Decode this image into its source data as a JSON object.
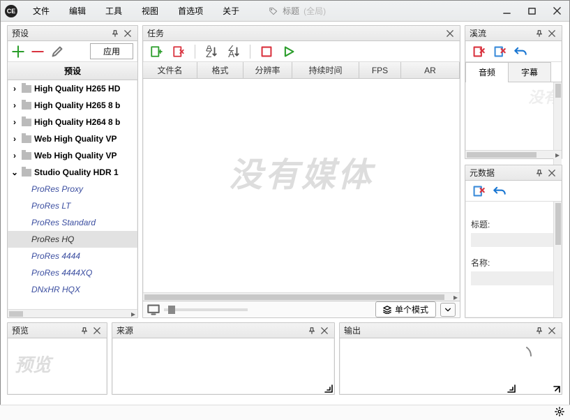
{
  "menubar": [
    "文件",
    "编辑",
    "工具",
    "视图",
    "首选项",
    "关于"
  ],
  "tag_label": "标题",
  "tag_scope": "(全局)",
  "panels": {
    "presets": "预设",
    "tasks": "任务",
    "streams": "溪流",
    "metadata": "元数据",
    "preview": "预览",
    "source": "来源",
    "output": "输出"
  },
  "presets": {
    "apply": "应用",
    "header": "预设",
    "folders": [
      "High Quality H265 HD",
      "High Quality H265 8 b",
      "High Quality H264 8 b",
      "Web High Quality VP",
      "Web High Quality VP",
      "Studio Quality HDR 1"
    ],
    "open_index": 5,
    "children": [
      "ProRes Proxy",
      "ProRes LT",
      "ProRes Standard",
      "ProRes HQ",
      "ProRes 4444",
      "ProRes 4444XQ",
      "DNxHR HQX"
    ],
    "selected_child": "ProRes HQ"
  },
  "tasks": {
    "columns": [
      "文件名",
      "格式",
      "分辨率",
      "持续时间",
      "FPS",
      "AR"
    ],
    "watermark": "没有媒体",
    "mode": "单个模式"
  },
  "streams": {
    "tabs": [
      "音频",
      "字幕"
    ],
    "active": 0,
    "ghost": "没有"
  },
  "metadata": {
    "fields": [
      "标题:",
      "名称:"
    ]
  },
  "preview_ghost": "预览"
}
